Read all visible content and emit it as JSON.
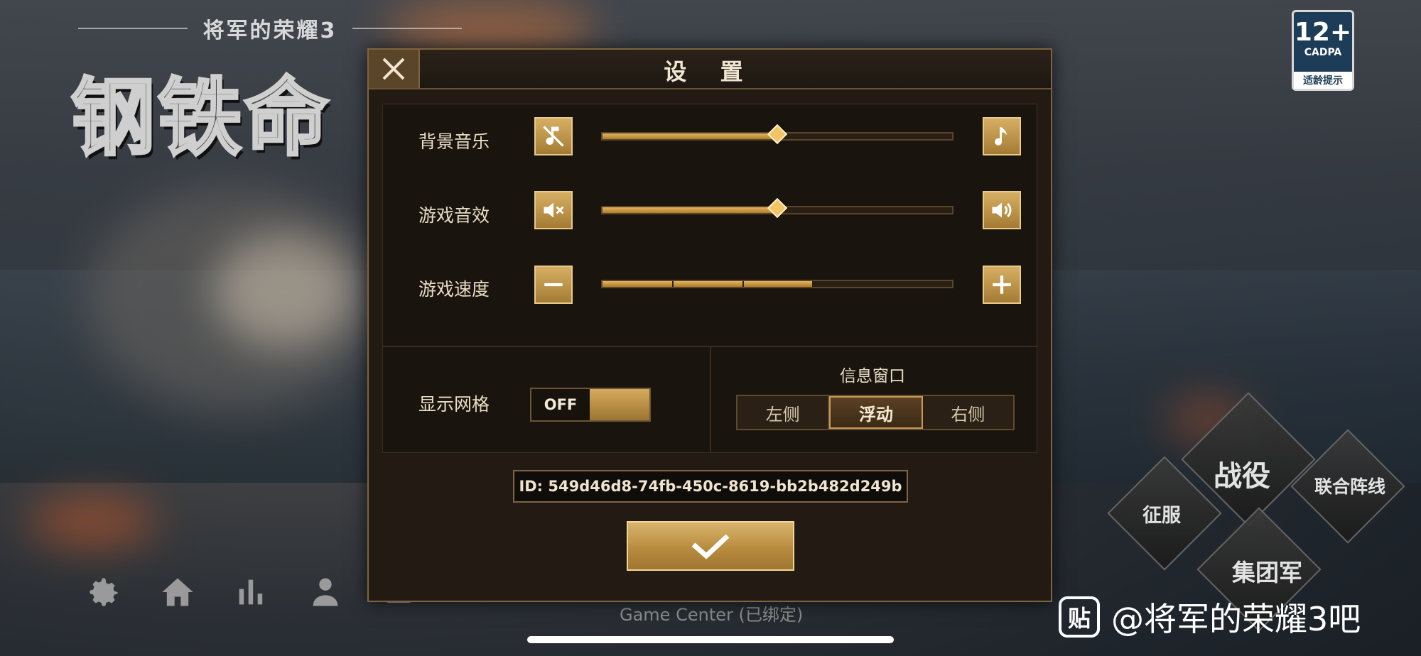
{
  "background": {
    "game_subtitle": "将军的荣耀3",
    "game_title": "钢铁命",
    "rating": {
      "age": "12+",
      "org": "CADPA",
      "tip": "适龄提示"
    },
    "bottom_bar": {
      "icons": [
        "gear-icon",
        "home-icon",
        "bar-chart-icon",
        "person-icon",
        "cloud-icon"
      ],
      "game_center_label": "Game Center (已绑定)"
    },
    "modes": {
      "campaign": "战役",
      "conquer": "征服",
      "united_front": "联合阵线",
      "army_group": "集团军"
    },
    "watermark": {
      "badge": "贴",
      "text": "@将军的荣耀3吧"
    }
  },
  "settings": {
    "title": "设 置",
    "close_icon": "close-icon",
    "background_music": {
      "label": "背景音乐",
      "value": 0.5,
      "left_icon": "music-off-icon",
      "right_icon": "music-note-icon"
    },
    "sound_effects": {
      "label": "游戏音效",
      "value": 0.5,
      "left_icon": "volume-mute-icon",
      "right_icon": "volume-up-icon"
    },
    "game_speed": {
      "label": "游戏速度",
      "level": 3,
      "max_level": 5,
      "left_icon": "minus-icon",
      "right_icon": "plus-icon"
    },
    "show_grid": {
      "label": "显示网格",
      "state": "OFF"
    },
    "info_window": {
      "label": "信息窗口",
      "options": [
        "左侧",
        "浮动",
        "右侧"
      ],
      "selected": "浮动"
    },
    "player_id": "ID: 549d46d8-74fb-450c-8619-bb2b482d249b",
    "confirm_icon": "checkmark-icon"
  },
  "colors": {
    "gold": "#c99a55",
    "panel": "#231b13",
    "slider_fill": "#e2b560"
  }
}
